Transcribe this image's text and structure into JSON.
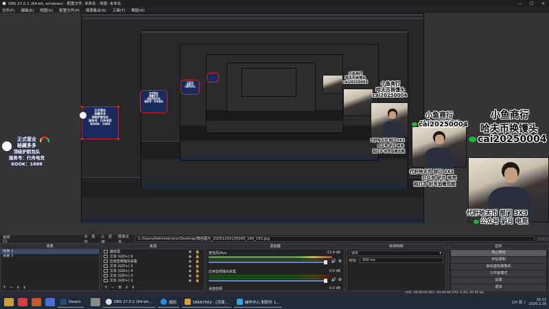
{
  "titlebar": {
    "title": "OBS 27.0.1 (64-bit, windows) - 配置文件: 未命名 - 场景: 未命名",
    "minimize": "—",
    "maximize": "☐",
    "close": "✕"
  },
  "menu": [
    "文件(F)",
    "编辑(E)",
    "视图(V)",
    "配置文件(P)",
    "场景集合(S)",
    "工具(T)",
    "帮助(H)"
  ],
  "overlay": {
    "brand_line1": "小鱼商行",
    "brand_line2": "哈夫币换馒头",
    "brand_line3": "cai20250004",
    "promo_line1": "代肝哈夫币 部门 3X3",
    "promo_line2": "公众号  驴月 电竞",
    "promo_line3": "招打手  封号追缴包赔"
  },
  "badge": {
    "line1": "正式营业",
    "line2": "秘藏多多",
    "line3": "顶级护航包队",
    "line4": "服务号：行舟电竞",
    "line5": "KOOK：1888"
  },
  "preview_toolbar": {
    "audio_label": "音频 11",
    "attr_label": "属性",
    "filter_label": "滤镜",
    "image_file_label": "图像文件",
    "path": "C:/Users/Administrator/Desktop/微信图片_20251202135000_140_193.jpg"
  },
  "scenes": {
    "header": "场景",
    "items": [
      "场景 2",
      "场景 3"
    ],
    "add": "+",
    "remove": "−",
    "up": "∧",
    "down": "∨"
  },
  "sources": {
    "header": "来源",
    "items": [
      {
        "name": "媒体源"
      },
      {
        "name": "文本 (GDI+) 6"
      },
      {
        "name": "应用音频输出采集"
      },
      {
        "name": "文本 (GDI+) 5"
      },
      {
        "name": "文本 (GDI+) 4"
      },
      {
        "name": "文本 (GDI+) 3"
      },
      {
        "name": "文本 (GDI+) 2"
      }
    ],
    "row_icons": "◉ 🔒"
  },
  "mixer": {
    "header": "混音器",
    "channels": [
      {
        "name": "麦克风/Aux",
        "db": "-13.9 dB"
      },
      {
        "name": "应用音频输出采集",
        "db": "0.0 dB"
      },
      {
        "name": "桌面音频",
        "db": "0.0 dB"
      }
    ]
  },
  "transitions": {
    "header": "转场特效",
    "type": "淡出",
    "duration_label": "时长",
    "duration_value": "300 ms"
  },
  "controls": {
    "header": "控件",
    "buttons": [
      "停止推流",
      "开始录制",
      "启动虚拟摄像机",
      "工作室模式",
      "设置",
      "退出"
    ]
  },
  "statusbar": {
    "text": "LIVE: 00:00:00   REC: 00:00:00   CPU: 0.4%, 60.00 fps"
  },
  "taskbar": {
    "apps": [
      "Steam",
      "OBS 27.0.1 (64-bit...",
      "战网",
      "58687562 - [页面...",
      "操作中心 和防外 1..."
    ],
    "tray_text": "CH  英  ♪",
    "time": "16:12",
    "date": "2026.2.26"
  },
  "colors": {
    "accent_red": "#dd2222",
    "wechat_green": "#1fb83a",
    "panel": "#232326",
    "taskbar": "#1f2a3a"
  }
}
